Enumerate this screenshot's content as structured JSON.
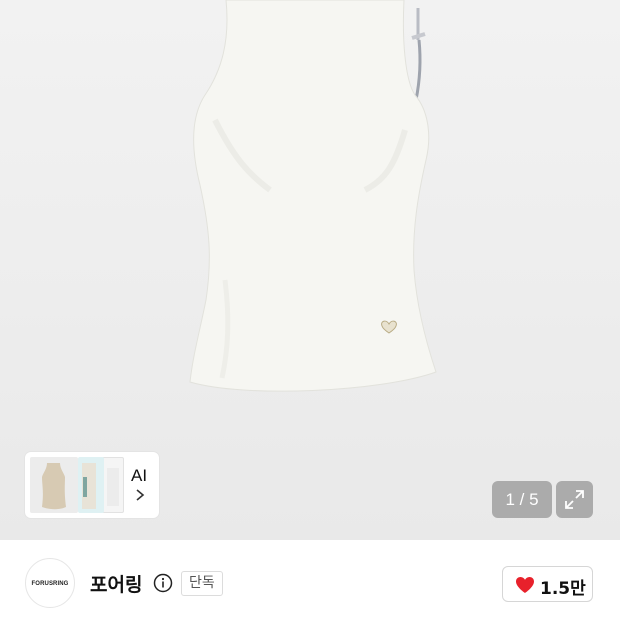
{
  "gallery": {
    "ai_card": {
      "label": "AI",
      "chevron": "chevron-right-icon"
    },
    "counter": "1 / 5",
    "expand_icon": "expand-icon"
  },
  "brand": {
    "logo_text": "FORUSRING",
    "name": "포어링",
    "info_icon": "info-icon",
    "badge": "단독"
  },
  "like": {
    "icon": "heart-icon",
    "count": "1.5만",
    "heart_color": "#e8212b"
  },
  "colors": {
    "hero_background": "#eeeeee",
    "top_color": "#f4f4f0",
    "overlay": "#969696"
  }
}
